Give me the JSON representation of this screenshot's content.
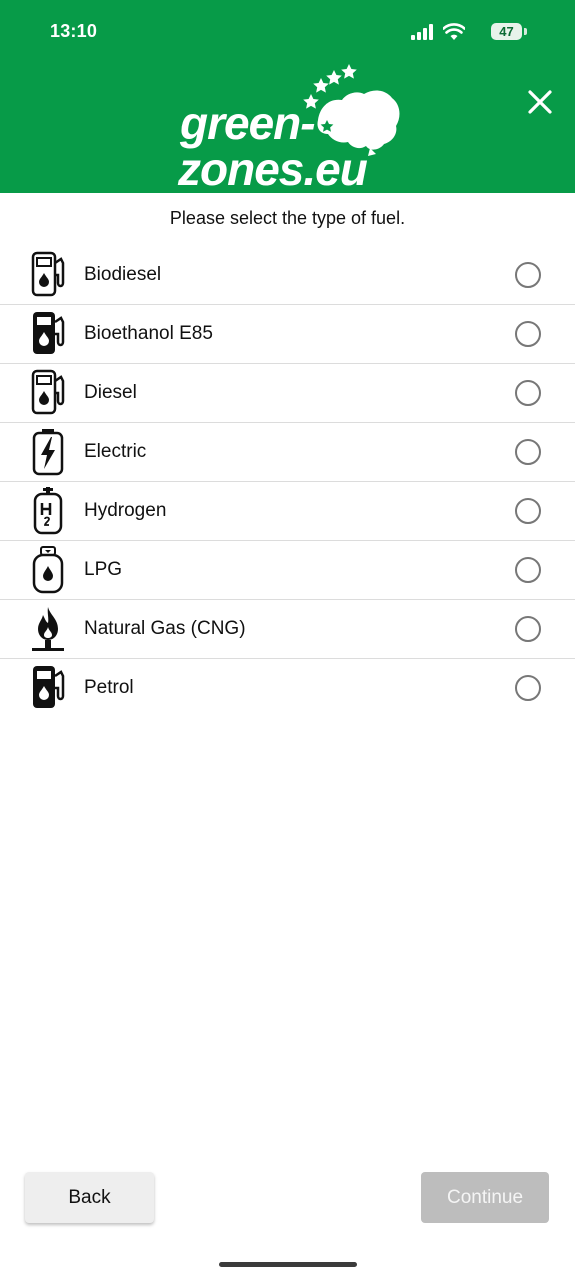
{
  "status_bar": {
    "time": "13:10",
    "battery": "47"
  },
  "header": {
    "logo_line1": "green-",
    "logo_line2": "zones.eu"
  },
  "instruction": "Please select the type of fuel.",
  "fuels": [
    {
      "label": "Biodiesel",
      "icon": "fuel-pump-outline-icon"
    },
    {
      "label": "Bioethanol E85",
      "icon": "fuel-pump-solid-icon"
    },
    {
      "label": "Diesel",
      "icon": "fuel-pump-outline-icon"
    },
    {
      "label": "Electric",
      "icon": "battery-bolt-icon"
    },
    {
      "label": "Hydrogen",
      "icon": "h2-cylinder-icon"
    },
    {
      "label": "LPG",
      "icon": "gas-cylinder-icon"
    },
    {
      "label": "Natural Gas (CNG)",
      "icon": "flame-icon"
    },
    {
      "label": "Petrol",
      "icon": "fuel-pump-solid-icon"
    }
  ],
  "buttons": {
    "back": "Back",
    "continue": "Continue"
  },
  "colors": {
    "brand_green": "#079b48",
    "continue_disabled": "#bdbdbd"
  }
}
